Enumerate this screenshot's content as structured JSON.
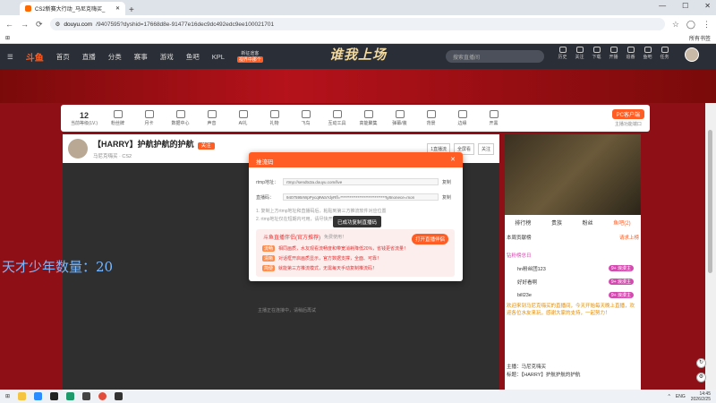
{
  "browser": {
    "tab_title": "CS2新赛大行动_马尼克嗨买_",
    "new_tab": "+",
    "url_domain": "douyu.com",
    "url_path": "/9407595?dyshid=17668d8e-91477e16dec9dc492edc9ee100021701",
    "bookmarks_right": "所有书签",
    "window_controls": [
      "—",
      "☐",
      "✕"
    ]
  },
  "site": {
    "logo": "斗鱼",
    "nav": [
      "首页",
      "直播",
      "分类",
      "赛事",
      "游戏",
      "鱼吧",
      "KPL"
    ],
    "hot_top": "新征途客",
    "hot_badge": "视界中那个",
    "banner_title": "谁我上场",
    "search_placeholder": "搜索直播间",
    "icons": [
      "历史",
      "关注",
      "下载",
      "开播",
      "追番",
      "鱼吧",
      "任务"
    ]
  },
  "toolbar": {
    "level_num": "12",
    "level_label": "当前等级(LV.)",
    "tools": [
      "粉丝牌",
      "月卡",
      "数据中心",
      "声音",
      "AI礼",
      "礼物",
      "飞鸟",
      "互动工具",
      "高能聚集",
      "弹幕/装",
      "背景",
      "边缘",
      "开黑"
    ],
    "pc_button": "PC客户端",
    "pc_label": "主播功能端口"
  },
  "room": {
    "title": "【HARRY】护航护航的护航",
    "follow": "关注",
    "sub_items": [
      "马尼克嗨买",
      "CS2"
    ],
    "buttons": [
      "1直播流",
      "全屏看",
      "关注"
    ]
  },
  "video": {
    "overlay_text": "天才少年数量：20",
    "loading": "主播正在连接中，请稍后再试"
  },
  "modal": {
    "title": "推流码",
    "close": "✕",
    "rtmp_label": "rtmp地址：",
    "rtmp_value": "rtmp://sendtx3a.douyu.com/live",
    "key_label": "直播码：",
    "key_value": "9407595rWpPycq9Wa?dyRfl=*****************************ty8nonece=mon",
    "copy": "复制",
    "tips": [
      "1. 复制上方rtmp地址和直播码后，粘贴到第三方推流软件对应位置",
      "2. rtmp地址仅在短期内可用，请尽快开播，有效期为5分钟"
    ],
    "copied_toast": "已成功复制直播码",
    "promo_title": "斗鱼直播伴侣(官方推荐)",
    "promo_free": "免费使用！",
    "promo_button": "打开直播伴侣",
    "promo_lines": [
      {
        "tag": "流畅",
        "text": "相同画质，水友观看流畅度和带宽消耗降低20%，省钱更省流量！"
      },
      {
        "tag": "清晰",
        "text": "对话框开启画质显示，官方数据支撑，全面、可靠！"
      },
      {
        "tag": "简便",
        "text": "就能第三方推流模式，无需每天手动复制推流码！"
      }
    ]
  },
  "sidebar": {
    "tabs": [
      "排行榜",
      "贵族",
      "粉丝",
      "鱼吧(2)"
    ],
    "row1": "本周贡献榜",
    "row1_right": "请求上榜",
    "weekly_label": "钻粉榜总日",
    "ranks": [
      {
        "name": "hn粉丝团123",
        "tag": "9+ 浪漫主"
      },
      {
        "name": "好好看啊",
        "tag": "9+ 浪漫主"
      },
      {
        "name": "bill23e",
        "tag": "9+ 浪漫主"
      }
    ],
    "notice": "欢迎来到马尼克嗨买的直播间，今天开始每天晚上直播，欢迎各位水友来玩，感谢大家的支持，一起努力！",
    "host_label": "主播：马尼克嗨买",
    "stream_label": "标题：【HARRY】护航护航的护航"
  },
  "taskbar": {
    "lang": "ENG",
    "time": "14:45",
    "date": "2026/2/25"
  },
  "colors": {
    "accent": "#ff5d23",
    "page_bg": "#8e1016"
  }
}
